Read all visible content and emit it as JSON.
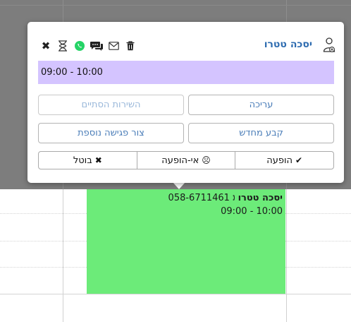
{
  "popup": {
    "client_name": "יסכה טטרו",
    "time_range": "09:00 - 10:00",
    "buttons": {
      "edit": "עריכה",
      "services_done": "השירות הסתיים",
      "reschedule": "קבע מחדש",
      "create_another": "צור פגישה נוספת"
    },
    "status": {
      "show": "הופעה",
      "no_show": "אי-הופעה",
      "cancel": "בוטל"
    },
    "icons": [
      "add-person-icon",
      "delete-icon",
      "email-icon",
      "sms-icon",
      "whatsapp-icon",
      "hourglass-icon",
      "close-icon"
    ]
  },
  "appointment": {
    "name": "יסכה טטרו",
    "phone": "058-6711461",
    "time": "09:00 - 10:00",
    "color": "#6ceb79"
  },
  "colors": {
    "time_bar": "#d4c4ff",
    "link": "#2e6cb0"
  }
}
